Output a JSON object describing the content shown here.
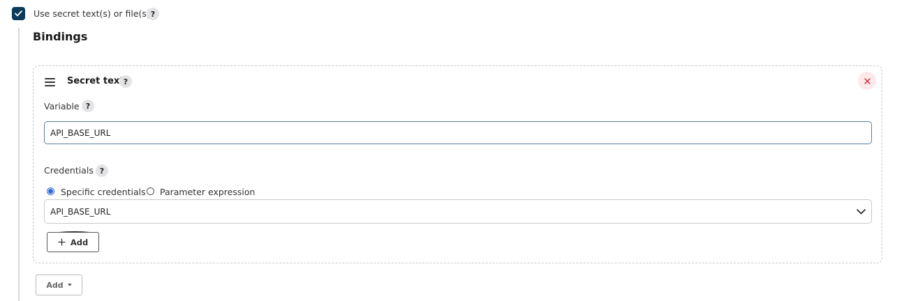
{
  "use_secret": {
    "label": "Use secret text(s) or file(s)",
    "checked": true,
    "help": "?"
  },
  "bindings": {
    "title": "Bindings",
    "items": [
      {
        "type_label": "Secret text",
        "help": "?",
        "delete_icon": "close-icon",
        "variable": {
          "label": "Variable",
          "help": "?",
          "value": "API_BASE_URL"
        },
        "credentials": {
          "label": "Credentials",
          "help": "?",
          "options": [
            "Specific credentials",
            "Parameter expression"
          ],
          "selected_option": "Specific credentials",
          "selected_value": "API_BASE_URL",
          "add_label": "Add"
        }
      }
    ],
    "add_label": "Add"
  },
  "colors": {
    "checkbox": "#0b3a5b",
    "delete_bg": "#fde8ea",
    "delete_fg": "#d42535",
    "radio_selected": "#2c68d8",
    "input_border": "#5a7ea0"
  }
}
